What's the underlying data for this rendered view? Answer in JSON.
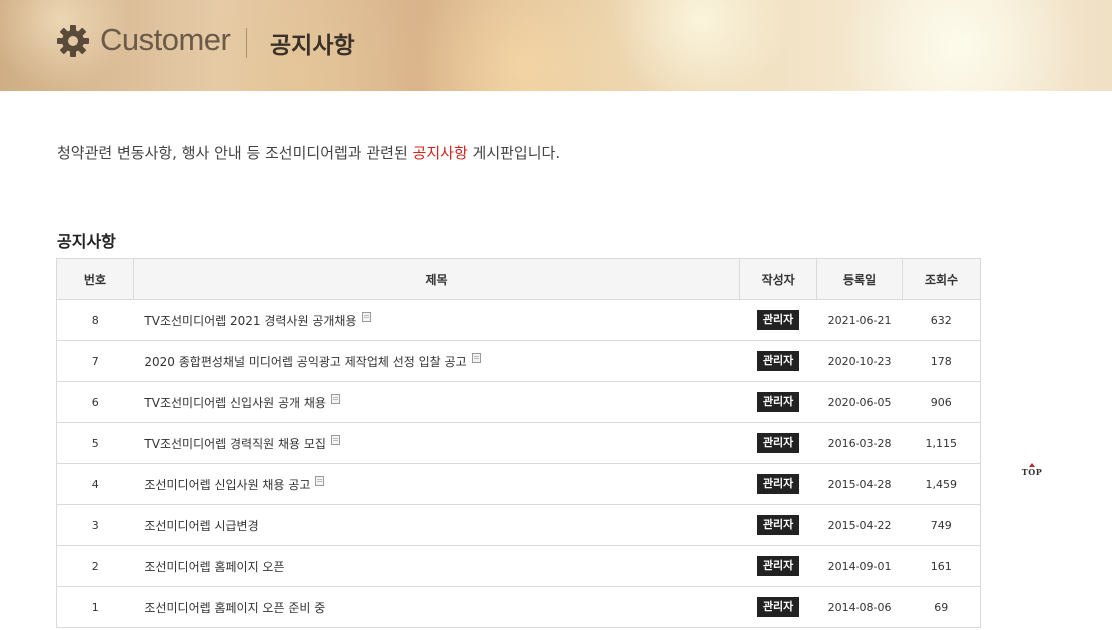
{
  "header": {
    "brand": "Customer",
    "breadcrumb": "공지사항",
    "icon": "gear-icon"
  },
  "intro": {
    "text_before": "청약관련 변동사항, 행사 안내 등 조선미디어렙과 관련된 ",
    "highlight": "공지사항",
    "text_after": " 게시판입니다.",
    "highlight_color": "#d0241f"
  },
  "section_title": "공지사항",
  "table": {
    "headers": [
      "번호",
      "제목",
      "작성자",
      "등록일",
      "조회수"
    ],
    "rows": [
      {
        "no": "8",
        "title": "TV조선미디어렙 2021 경력사원 공개채용",
        "attachment": true,
        "author": "관리자",
        "date": "2021-06-21",
        "views": "632"
      },
      {
        "no": "7",
        "title": "2020 종합편성채널 미디어렙 공익광고 제작업체 선정 입찰 공고",
        "attachment": true,
        "author": "관리자",
        "date": "2020-10-23",
        "views": "178"
      },
      {
        "no": "6",
        "title": "TV조선미디어렙 신입사원 공개 채용",
        "attachment": true,
        "author": "관리자",
        "date": "2020-06-05",
        "views": "906"
      },
      {
        "no": "5",
        "title": "TV조선미디어렙 경력직원 채용 모집",
        "attachment": true,
        "author": "관리자",
        "date": "2016-03-28",
        "views": "1,115"
      },
      {
        "no": "4",
        "title": "조선미디어렙 신입사원 채용 공고",
        "attachment": true,
        "author": "관리자",
        "date": "2015-04-28",
        "views": "1,459"
      },
      {
        "no": "3",
        "title": "조선미디어렙 시급변경",
        "attachment": false,
        "author": "관리자",
        "date": "2015-04-22",
        "views": "749"
      },
      {
        "no": "2",
        "title": "조선미디어렙 홈페이지 오픈",
        "attachment": false,
        "author": "관리자",
        "date": "2014-09-01",
        "views": "161"
      },
      {
        "no": "1",
        "title": "조선미디어렙 홈페이지 오픈 준비 중",
        "attachment": false,
        "author": "관리자",
        "date": "2014-08-06",
        "views": "69"
      }
    ]
  },
  "top_button": {
    "label": "TOP",
    "icon": "up-arrow-icon",
    "arrow_color": "#c0242c"
  }
}
